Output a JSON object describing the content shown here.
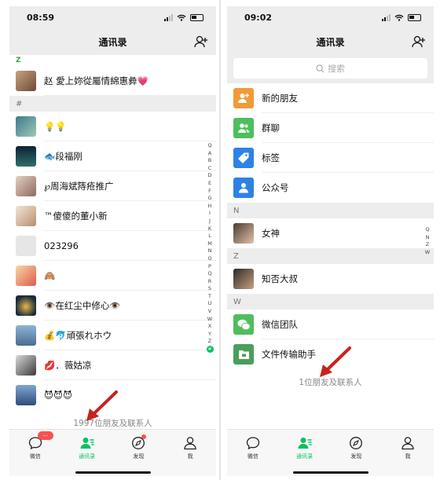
{
  "left": {
    "time": "08:59",
    "title": "通讯录",
    "z_letter": "Z",
    "z_contact": "赵 愛上妳從屬情綿惠彜💗",
    "hash_section": "#",
    "contacts": [
      "💡💡",
      "🐟段福刚",
      "℘周海斌ؓ痔疮推广",
      "™傻傻的董小新",
      "023296",
      "🙈",
      "👁️在红尘中修心👁️",
      "💰🐬頑張れホウ",
      "💋．薇姑凉",
      "😈😈😈"
    ],
    "count": "1997位朋友及联系人",
    "index_letters": [
      "Q",
      "A",
      "B",
      "C",
      "D",
      "E",
      "F",
      "G",
      "H",
      "I",
      "J",
      "K",
      "L",
      "M",
      "N",
      "O",
      "P",
      "Q",
      "R",
      "S",
      "T",
      "U",
      "V",
      "W",
      "X",
      "Y",
      "Z"
    ],
    "index_active": "#",
    "chat_badge": "···"
  },
  "right": {
    "time": "09:02",
    "title": "通讯录",
    "search_placeholder": "搜索",
    "functions": [
      {
        "label": "新的朋友",
        "color": "#f19a38"
      },
      {
        "label": "群聊",
        "color": "#4fbe5c"
      },
      {
        "label": "标签",
        "color": "#2d82e6"
      },
      {
        "label": "公众号",
        "color": "#2d82e6"
      }
    ],
    "section_n": "N",
    "contact_n": "女神",
    "section_z": "Z",
    "contact_z": "知否大叔",
    "section_w": "W",
    "contact_w1": "微信团队",
    "contact_w2": "文件传输助手",
    "count": "1位朋友及联系人",
    "index_letters": [
      "Q",
      "N",
      "Z",
      "W"
    ]
  },
  "tabs": [
    "微信",
    "通讯录",
    "发现",
    "我"
  ]
}
